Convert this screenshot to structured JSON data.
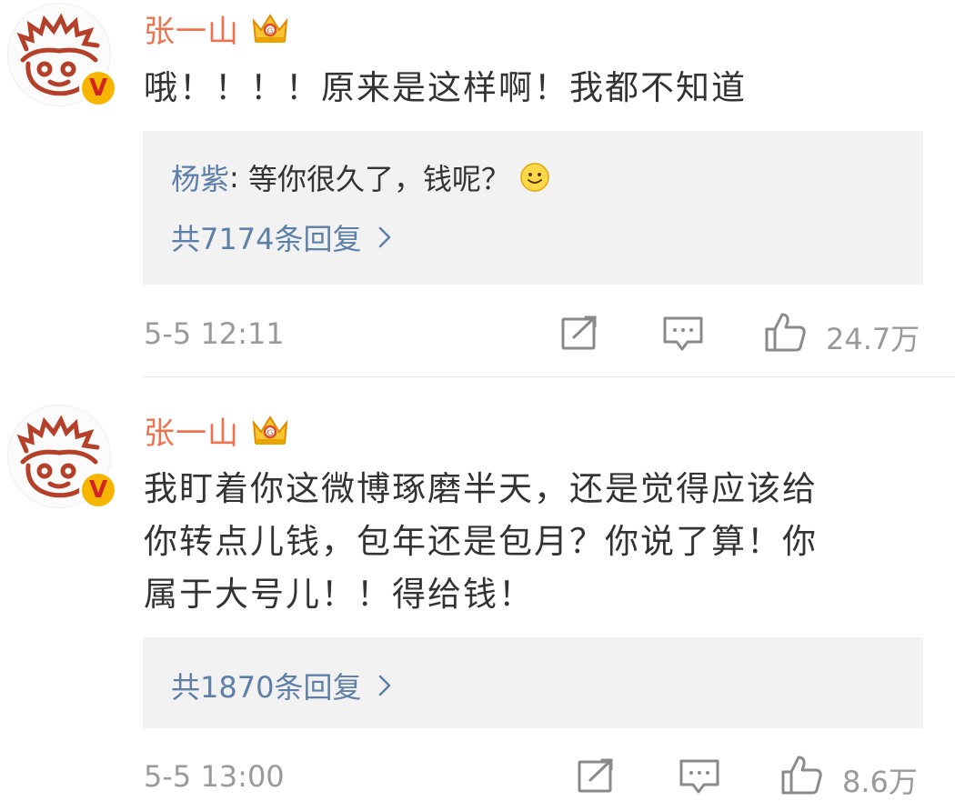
{
  "comments": [
    {
      "username": "张一山",
      "text": "哦！！！！原来是这样啊！我都不知道",
      "reply_preview": {
        "author": "杨紫",
        "separator": ": ",
        "text": "等你很久了，钱呢？"
      },
      "reply_count": "共7174条回复",
      "time": "5-5 12:11",
      "likes": "24.7万"
    },
    {
      "username": "张一山",
      "text_lines": [
        "我盯着你这微博琢磨半天，还是觉得应该给",
        "你转点儿钱，包年还是包月？你说了算！你",
        "属于大号儿！！得给钱！"
      ],
      "reply_count": "共1870条回复",
      "time": "5-5 13:00",
      "likes": "8.6万"
    }
  ],
  "badge_letter": "V",
  "icons": [
    "monkey-avatar",
    "vip-crown-icon",
    "verified-v-badge",
    "smiley-icon",
    "chevron-right-icon",
    "repost-icon",
    "comment-icon",
    "like-icon"
  ],
  "colors": {
    "username": "#eb7350",
    "link": "#5d7fa8",
    "meta": "#9a9a9a",
    "reply_bg": "#f2f2f2",
    "badge": "#f7b500"
  }
}
